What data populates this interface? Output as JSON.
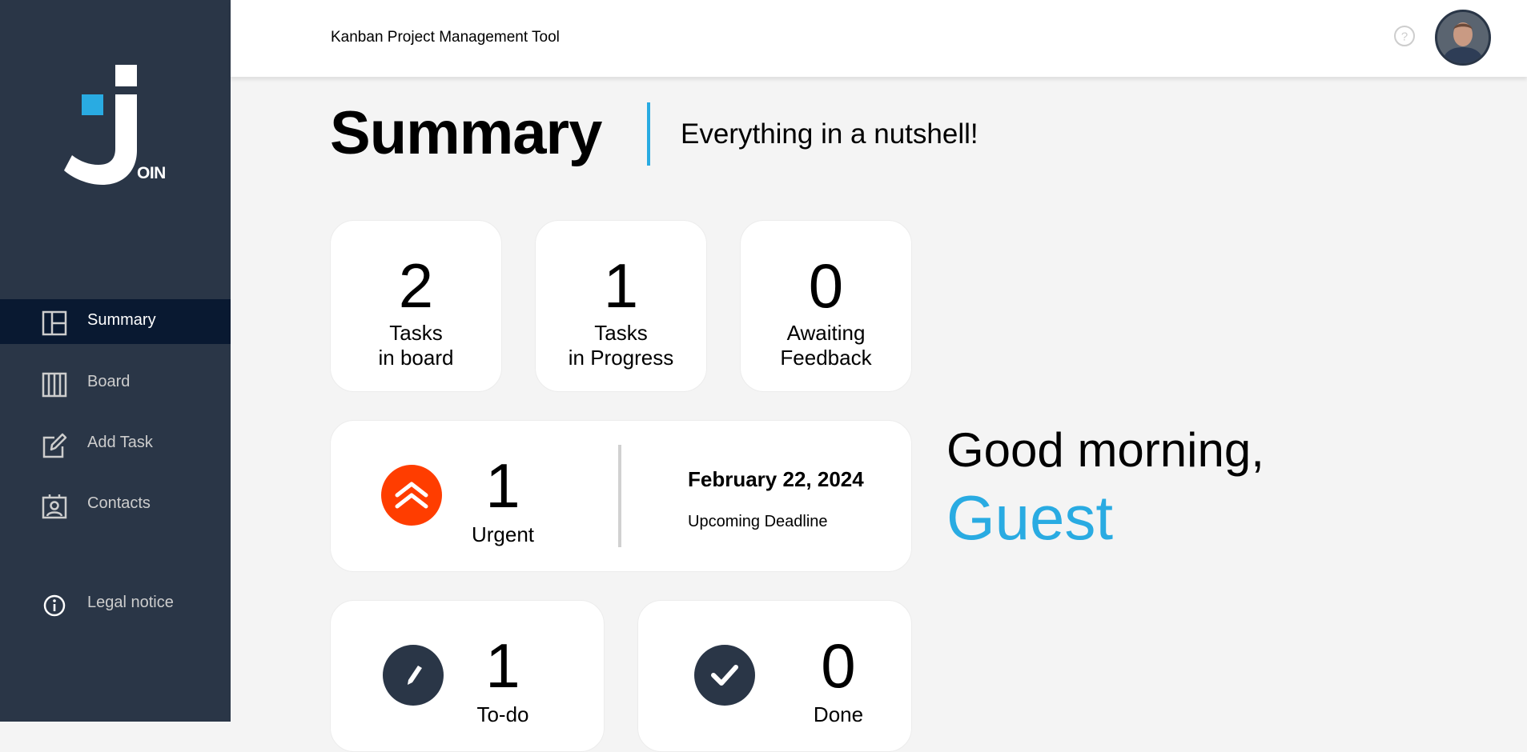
{
  "app": {
    "logo_text": "OIN",
    "header_title": "Kanban Project Management Tool"
  },
  "sidebar": {
    "items": [
      {
        "label": "Summary",
        "icon": "summary-icon",
        "active": true
      },
      {
        "label": "Board",
        "icon": "board-icon",
        "active": false
      },
      {
        "label": "Add Task",
        "icon": "add-task-icon",
        "active": false
      },
      {
        "label": "Contacts",
        "icon": "contacts-icon",
        "active": false
      }
    ],
    "legal": {
      "label": "Legal notice",
      "icon": "info-icon"
    }
  },
  "header": {
    "help_icon": "help-icon",
    "avatar_icon": "user-avatar"
  },
  "main": {
    "title": "Summary",
    "subtitle": "Everything in a nutshell!",
    "stats": [
      {
        "number": "2",
        "line1": "Tasks",
        "line2": "in board"
      },
      {
        "number": "1",
        "line1": "Tasks",
        "line2": "in Progress"
      },
      {
        "number": "0",
        "line1": "Awaiting",
        "line2": "Feedback"
      }
    ],
    "urgent": {
      "number": "1",
      "label": "Urgent",
      "date": "February 22, 2024",
      "date_label": "Upcoming Deadline"
    },
    "todo": {
      "number": "1",
      "label": "To-do"
    },
    "done": {
      "number": "0",
      "label": "Done"
    }
  },
  "greeting": {
    "text": "Good morning,",
    "name": "Guest"
  },
  "colors": {
    "sidebar": "#2a3647",
    "active": "#091931",
    "accent": "#29abe2",
    "urgent": "#ff3d00"
  }
}
